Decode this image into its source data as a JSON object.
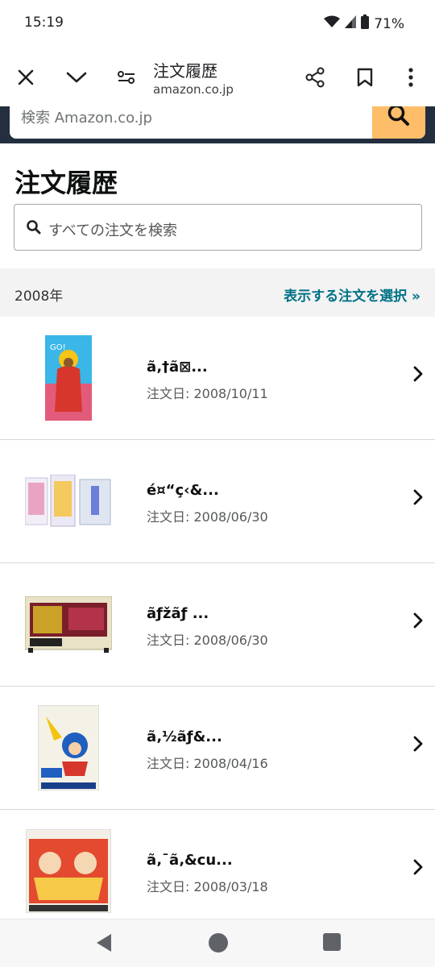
{
  "status": {
    "time": "15:19",
    "battery": "71%"
  },
  "toolbar": {
    "title": "注文履歴",
    "url": "amazon.co.jp"
  },
  "amazon_search": {
    "placeholder": "検索 Amazon.co.jp"
  },
  "page": {
    "title": "注文履歴"
  },
  "order_search": {
    "placeholder": "すべての注文を検索"
  },
  "year_bar": {
    "year": "2008年",
    "filter_link": "表示する注文を選択 »"
  },
  "orders": [
    {
      "title": "ã‚†ã⊠...",
      "date": "注文日: 2008/10/11",
      "thumb": "game-box-art"
    },
    {
      "title": "é¤“ç‹&...",
      "date": "注文日: 2008/06/30",
      "thumb": "game-box-set"
    },
    {
      "title": "ãƒžãƒ ...",
      "date": "注文日: 2008/06/30",
      "thumb": "game-cartridge"
    },
    {
      "title": "ã‚½ãƒ&...",
      "date": "注文日: 2008/04/16",
      "thumb": "game-box-art"
    },
    {
      "title": "ã‚¯ã‚&cu...",
      "date": "注文日: 2008/03/18",
      "thumb": "game-box-art"
    }
  ],
  "colors": {
    "amazon_dark": "#232f3e",
    "search_button": "#febd69",
    "link": "#007185"
  }
}
